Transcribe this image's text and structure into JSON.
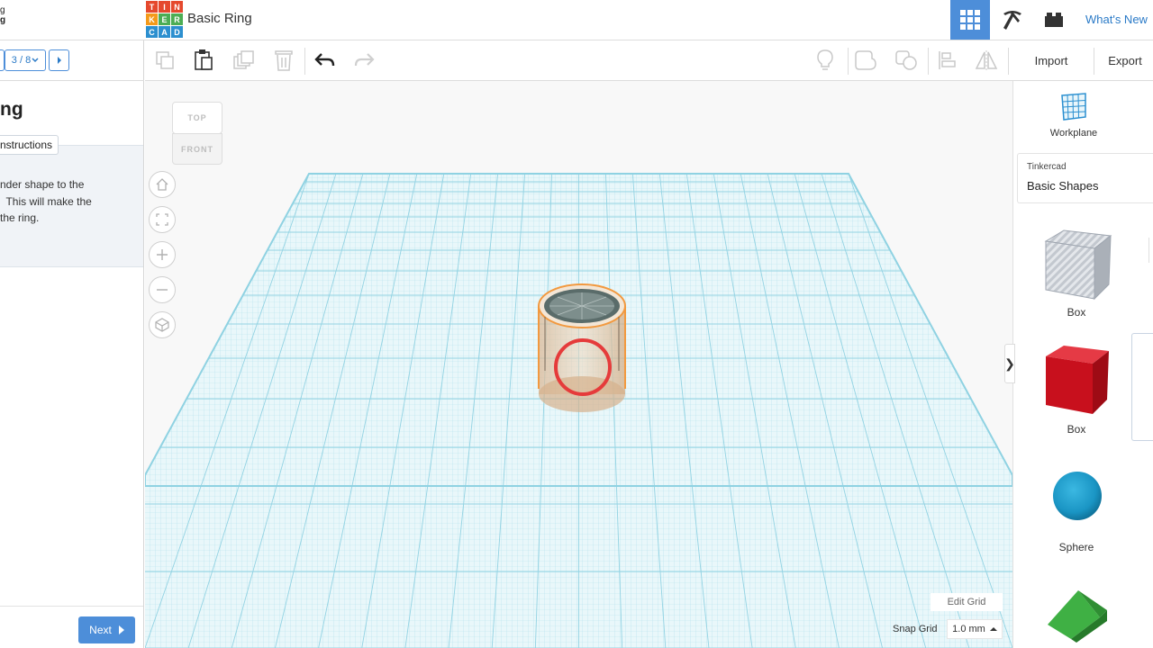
{
  "header": {
    "crumb_line1": "g",
    "crumb_line2": "g",
    "logo_letters": [
      "T",
      "I",
      "N",
      "K",
      "E",
      "R",
      "C",
      "A",
      "D"
    ],
    "logo_colors": [
      "#e5492d",
      "#e5492d",
      "#e5492d",
      "#f49a1a",
      "#4cad54",
      "#4cad54",
      "#2c8fcf",
      "#2c8fcf",
      "#2c8fcf"
    ],
    "doc_title": "Basic Ring",
    "whats_new": "What's New",
    "icons": {
      "grid": "3d-view-grid-icon",
      "pickaxe": "pickaxe-icon",
      "brick": "brick-icon"
    },
    "accent": "#4d8ed9"
  },
  "lesson": {
    "step": "3 / 8",
    "title": "ng",
    "instructions_tab": "nstructions",
    "instructions_text": "nder shape to the\n  This will make the\nthe ring.",
    "next_label": "Next"
  },
  "toolbar": {
    "import_label": "Import",
    "export_label": "Export",
    "icons": [
      "copy-icon",
      "paste-icon",
      "duplicate-icon",
      "delete-icon",
      "undo-icon",
      "redo-icon",
      "note-icon",
      "group-icon",
      "ungroup-icon",
      "align-icon",
      "mirror-icon"
    ]
  },
  "workspace": {
    "viewcube_top": "TOP",
    "viewcube_front": "FRONT",
    "view_buttons": [
      "home-view-icon",
      "fit-view-icon",
      "zoom-in-icon",
      "zoom-out-icon",
      "perspective-icon"
    ],
    "edit_grid": "Edit Grid",
    "snap_label": "Snap Grid",
    "snap_value": "1.0 mm",
    "grid_color": "#aee4ef",
    "selection_color": "#f2993f",
    "highlight_color": "#e53b3b"
  },
  "right_panel": {
    "workplane_label": "Workplane",
    "library_source": "Tinkercad",
    "library_name": "Basic Shapes",
    "shapes": [
      {
        "label": "Box",
        "kind": "box-hole",
        "color": "#b9bec6"
      },
      {
        "label": "Box",
        "kind": "box",
        "color": "#d0121f"
      },
      {
        "label": "Sphere",
        "kind": "sphere",
        "color": "#1a9bc9"
      },
      {
        "label": "",
        "kind": "roof",
        "color": "#35a83a"
      }
    ]
  }
}
